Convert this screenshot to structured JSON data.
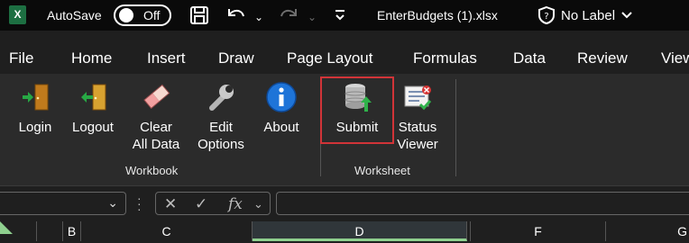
{
  "titlebar": {
    "app_logo": "X",
    "autosave_label": "AutoSave",
    "autosave_state": "Off",
    "document_title": "EnterBudgets (1).xlsx",
    "label_status": "No Label",
    "icons": [
      "save-icon",
      "undo-icon",
      "redo-icon",
      "customize-icon",
      "shield-icon"
    ]
  },
  "menu": {
    "tabs": [
      "File",
      "Home",
      "Insert",
      "Draw",
      "Page Layout",
      "Formulas",
      "Data",
      "Review",
      "View"
    ]
  },
  "ribbon": {
    "groups": [
      {
        "label": "Workbook",
        "buttons": [
          {
            "line1": "Login",
            "line2": "",
            "icon": "login-door-icon"
          },
          {
            "line1": "Logout",
            "line2": "",
            "icon": "logout-door-icon"
          },
          {
            "line1": "Clear",
            "line2": "All Data",
            "icon": "eraser-icon"
          },
          {
            "line1": "Edit",
            "line2": "Options",
            "icon": "wrench-icon"
          },
          {
            "line1": "About",
            "line2": "",
            "icon": "info-icon"
          }
        ]
      },
      {
        "label": "Worksheet",
        "buttons": [
          {
            "line1": "Submit",
            "line2": "",
            "icon": "database-upload-icon"
          },
          {
            "line1": "Status",
            "line2": "Viewer",
            "icon": "status-viewer-icon"
          }
        ]
      }
    ],
    "highlight_color": "#d13438"
  },
  "formula_bar": {
    "fx_label": "fx"
  },
  "columns": [
    "B",
    "C",
    "D",
    "F",
    "G"
  ],
  "selected_column": "D",
  "colors": {
    "background": "#1f1f1f",
    "ribbon": "#2b2b2b",
    "excel_green": "#1d6f42",
    "selection_green": "#8fd08f"
  }
}
